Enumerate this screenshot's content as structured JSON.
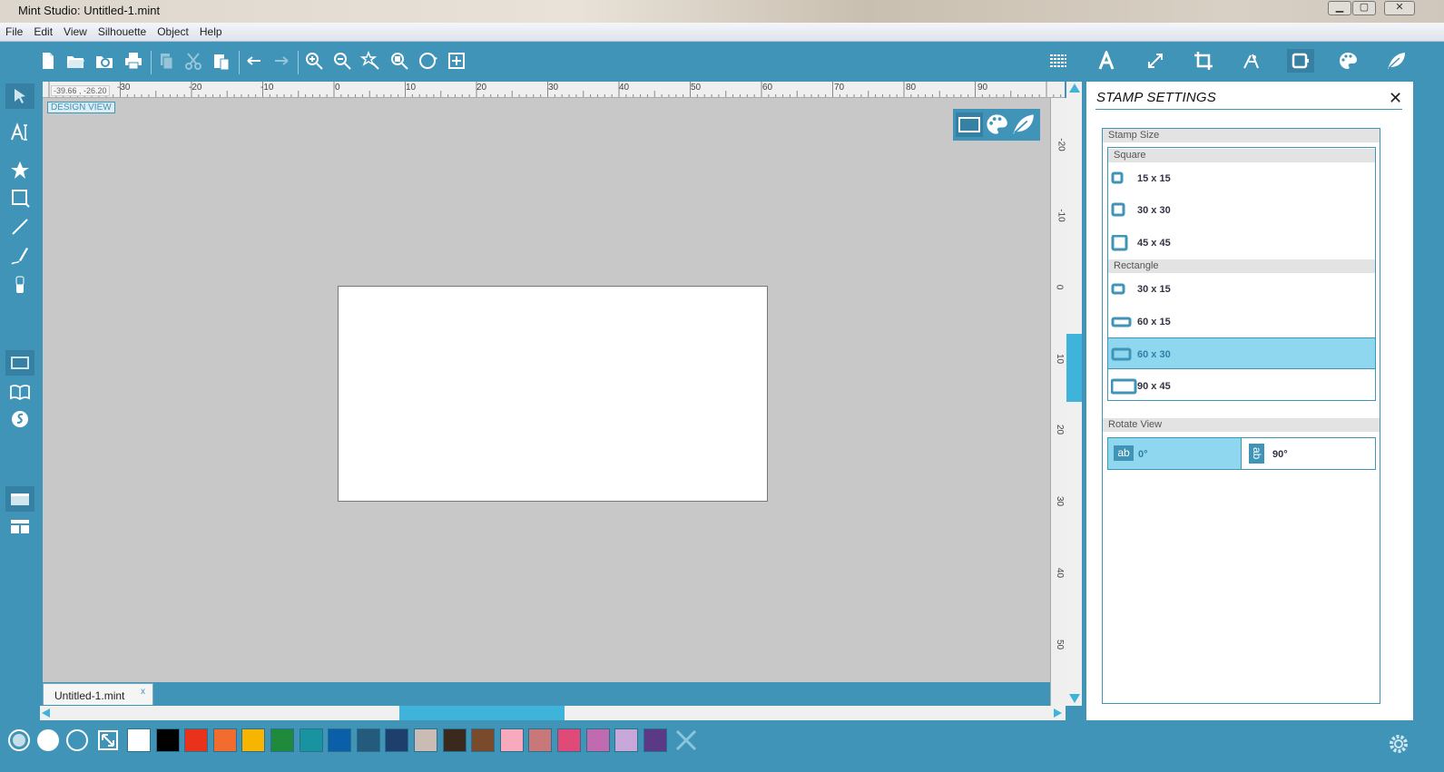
{
  "window": {
    "title": "Mint Studio: Untitled-1.mint",
    "minimize": "▁",
    "maximize": "▢",
    "close": "✕"
  },
  "menu": [
    "File",
    "Edit",
    "View",
    "Silhouette",
    "Object",
    "Help"
  ],
  "ruler": {
    "coord_readout": "-39.66 , -26.20",
    "h_labels": [
      "-30",
      "-20",
      "-10",
      "0",
      "10",
      "20",
      "30",
      "40",
      "50",
      "60",
      "70",
      "80",
      "90"
    ],
    "v_labels": [
      "-20",
      "-10",
      "0",
      "10",
      "20",
      "30",
      "40",
      "50"
    ]
  },
  "canvas": {
    "design_view_label": "DESIGN VIEW"
  },
  "tabs": [
    {
      "label": "Untitled-1.mint",
      "close": "x"
    }
  ],
  "panel": {
    "title": "STAMP SETTINGS",
    "close": "✕",
    "stamp_size_label": "Stamp Size",
    "square_label": "Square",
    "square_sizes": [
      "15 x 15",
      "30 x 30",
      "45 x 45"
    ],
    "rectangle_label": "Rectangle",
    "rectangle_sizes": [
      "30 x 15",
      "60 x 15",
      "60 x 30",
      "90 x 45"
    ],
    "selected_size": "60 x 30",
    "rotate_view_label": "Rotate View",
    "rotate_options": [
      "0°",
      "90°"
    ],
    "rotate_icon_text": "ab",
    "selected_rotation": "0°"
  },
  "palette": [
    "#ffffff",
    "#000000",
    "#e8321c",
    "#f26b2f",
    "#f7b500",
    "#1f8a3c",
    "#1893a0",
    "#0b5ea8",
    "#245a7c",
    "#1c3f6e",
    "#c8bcb4",
    "#3a2a1e",
    "#7a4a2c",
    "#f6aabc",
    "#c87878",
    "#e04a78",
    "#c06ab0",
    "#c8a8d8",
    "#5a3a86"
  ],
  "colors": {
    "accent": "#3f94b8",
    "selected_row": "#8fd6ef",
    "canvas_bg": "#c8c8c8"
  }
}
